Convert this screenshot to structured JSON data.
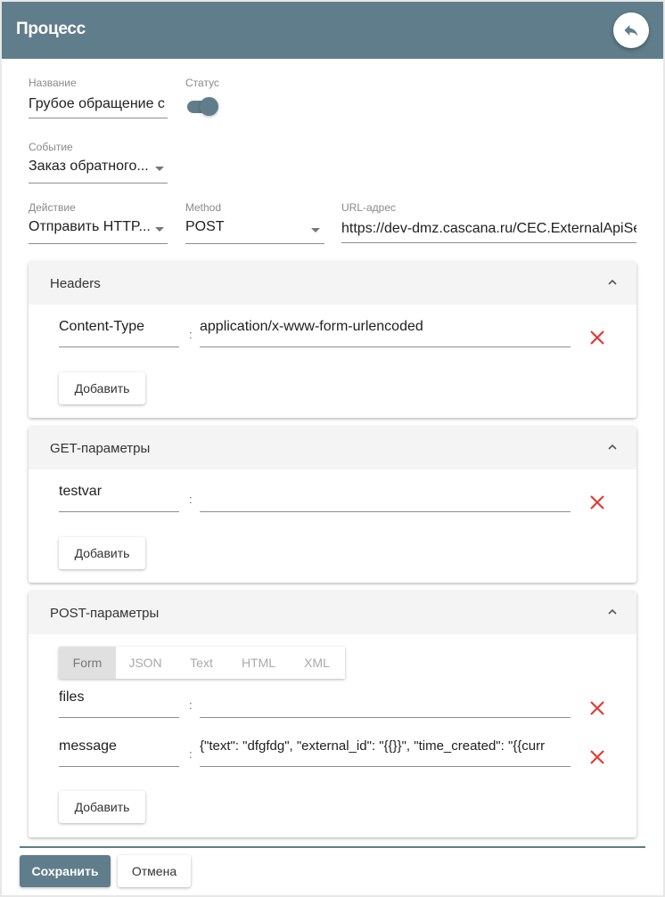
{
  "header": {
    "title": "Процесс",
    "back_icon": "reply-arrow-icon"
  },
  "form": {
    "name": {
      "label": "Название",
      "value": "Грубое обращение с"
    },
    "status": {
      "label": "Статус",
      "enabled": true
    },
    "event": {
      "label": "Событие",
      "value": "Заказ обратного..."
    },
    "action": {
      "label": "Действие",
      "value": "Отправить HTTP..."
    },
    "method": {
      "label": "Method",
      "value": "POST"
    },
    "url": {
      "label": "URL-адрес",
      "value": "https://dev-dmz.cascana.ru/CEC.ExternalApiSe"
    }
  },
  "panels": {
    "headers": {
      "title": "Headers",
      "rows": [
        {
          "key": "Content-Type",
          "value": "application/x-www-form-urlencoded"
        }
      ],
      "add_label": "Добавить"
    },
    "get_params": {
      "title": "GET-параметры",
      "rows": [
        {
          "key": "testvar",
          "value": ""
        }
      ],
      "add_label": "Добавить"
    },
    "post_params": {
      "title": "POST-параметры",
      "tabs": [
        {
          "label": "Form",
          "active": true
        },
        {
          "label": "JSON",
          "active": false
        },
        {
          "label": "Text",
          "active": false
        },
        {
          "label": "HTML",
          "active": false
        },
        {
          "label": "XML",
          "active": false
        }
      ],
      "rows": [
        {
          "key": "files",
          "value": ""
        },
        {
          "key": "message",
          "value": "{\"text\": \"dfgfdg\",   \"external_id\": \"{{}}\",   \"time_created\": \"{{curr"
        }
      ],
      "add_label": "Добавить"
    }
  },
  "separator": ":",
  "footer": {
    "save_label": "Сохранить",
    "cancel_label": "Отмена"
  },
  "colors": {
    "primary": "#607d8b",
    "delete": "#e53935"
  }
}
